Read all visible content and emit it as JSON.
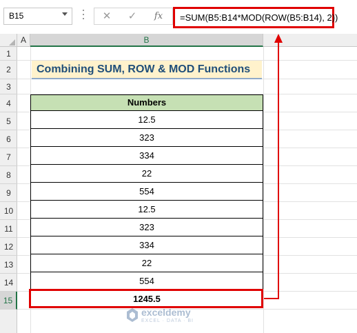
{
  "formula_bar": {
    "name_box": "B15",
    "cancel_icon": "close-icon",
    "enter_icon": "checkmark-icon",
    "fx_label": "fx",
    "formula": "=SUM(B5:B14*MOD(ROW(B5:B14), 2))"
  },
  "columns": [
    "A",
    "B"
  ],
  "selected_column": "B",
  "rows": [
    "1",
    "2",
    "3",
    "4",
    "5",
    "6",
    "7",
    "8",
    "9",
    "10",
    "11",
    "12",
    "13",
    "14",
    "15"
  ],
  "selected_row": "15",
  "sheet": {
    "title": "Combining SUM, ROW & MOD Functions",
    "table_header": "Numbers",
    "values": [
      "12.5",
      "323",
      "334",
      "22",
      "554",
      "12.5",
      "323",
      "334",
      "22",
      "554"
    ],
    "total": "1245.5"
  },
  "watermark": {
    "brand": "exceldemy",
    "tagline": "EXCEL · DATA · BI"
  },
  "colors": {
    "highlight": "#e00000",
    "title_fill": "#fff2cc",
    "title_text": "#1f4e79",
    "header_fill": "#c6e0b4",
    "selection": "#217346"
  }
}
